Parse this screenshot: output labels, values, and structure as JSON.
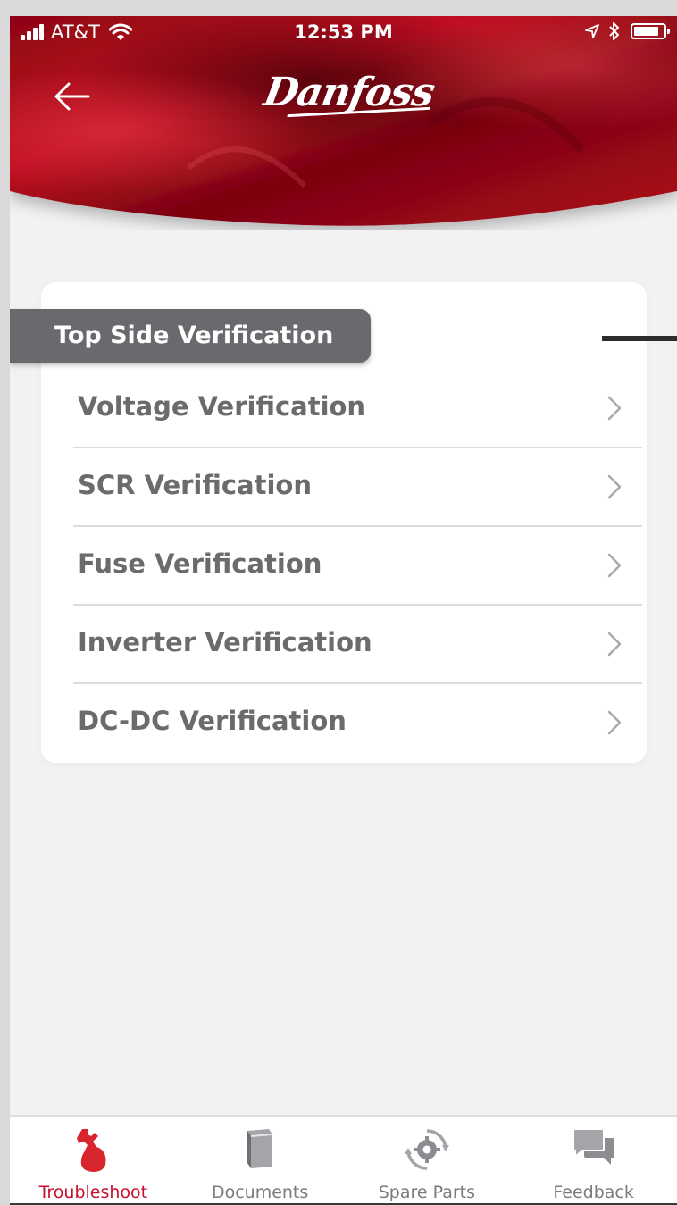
{
  "status_bar": {
    "carrier": "AT&T",
    "time": "12:53 PM"
  },
  "header": {
    "brand": "Danfoss",
    "brand_color": "#c8102e"
  },
  "section": {
    "title": "Top Side Verification"
  },
  "items": [
    {
      "label": "Voltage Verification"
    },
    {
      "label": "SCR Verification"
    },
    {
      "label": "Fuse Verification"
    },
    {
      "label": "Inverter Verification"
    },
    {
      "label": "DC-DC Verification"
    }
  ],
  "tabbar": {
    "tabs": [
      {
        "label": "Troubleshoot",
        "icon": "troubleshoot-icon",
        "active": true
      },
      {
        "label": "Documents",
        "icon": "document-icon",
        "active": false
      },
      {
        "label": "Spare Parts",
        "icon": "gear-refresh-icon",
        "active": false
      },
      {
        "label": "Feedback",
        "icon": "chat-bubbles-icon",
        "active": false
      }
    ]
  }
}
